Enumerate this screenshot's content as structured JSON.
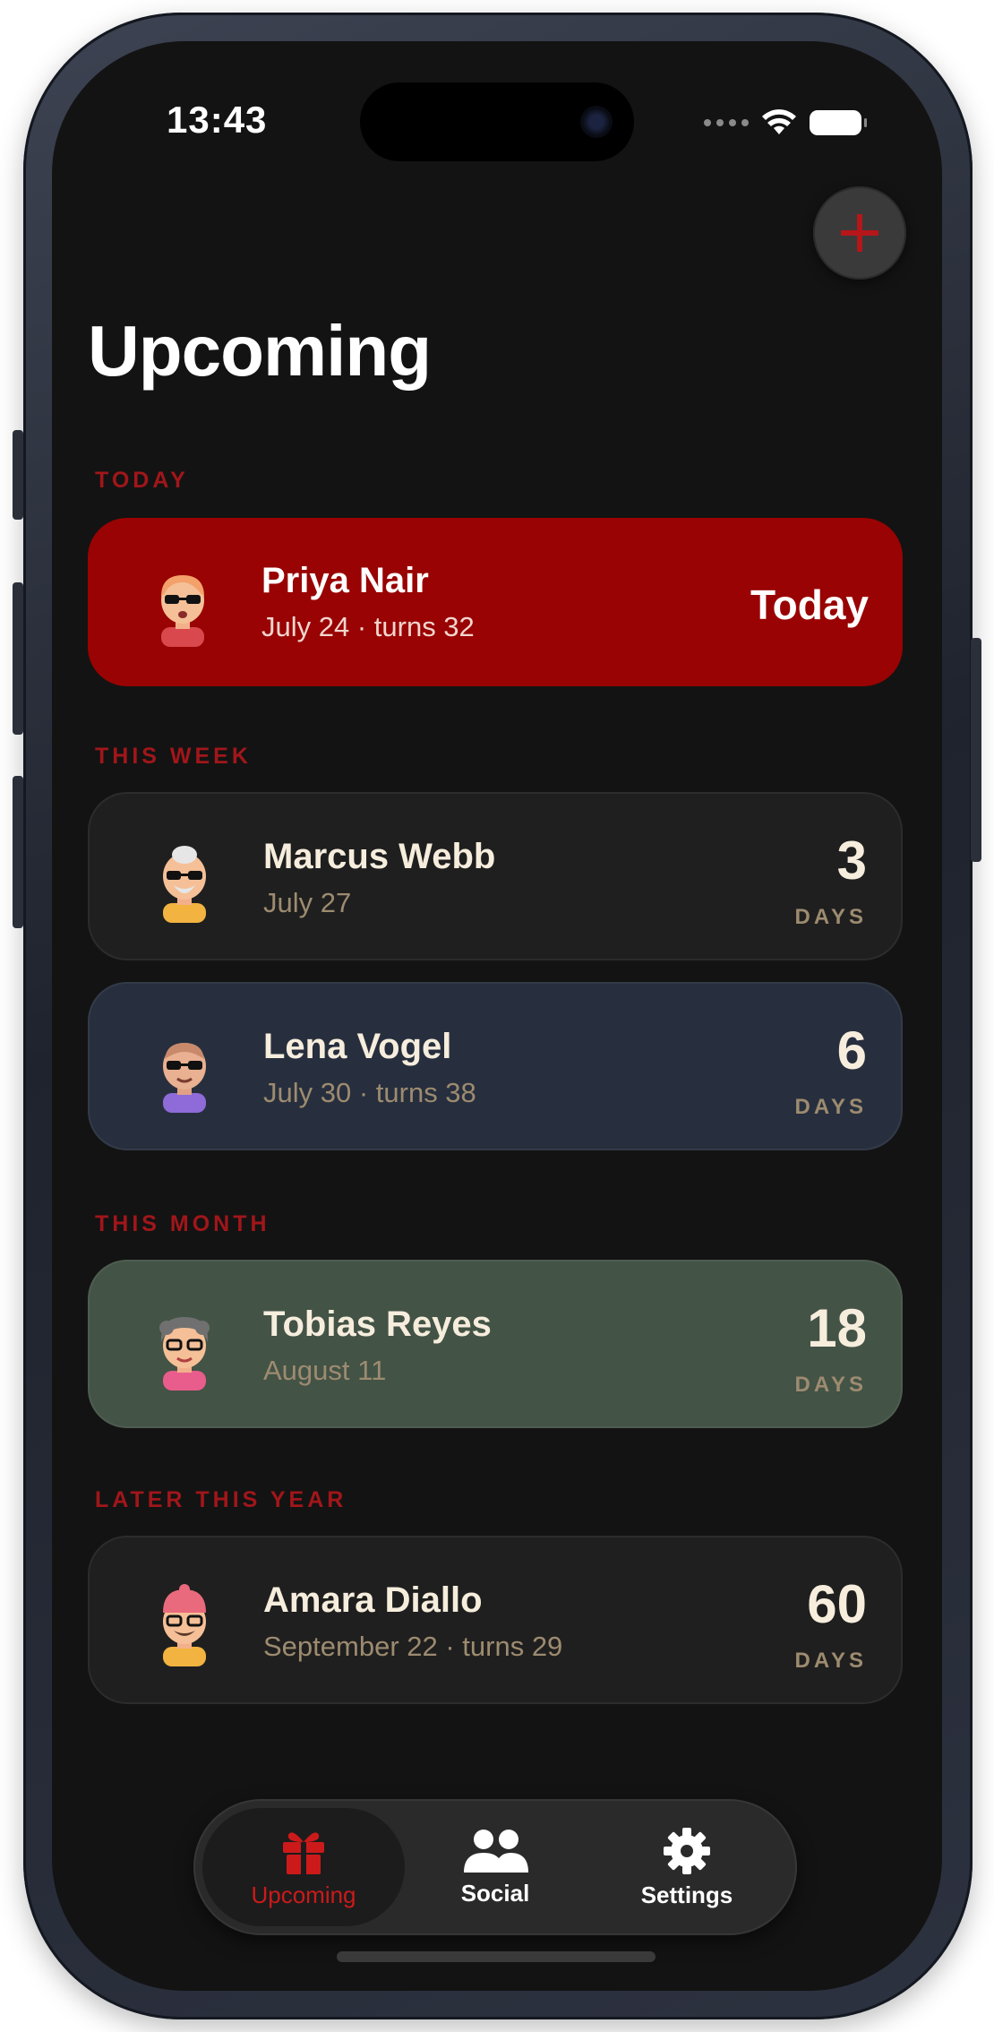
{
  "status": {
    "time": "13:43"
  },
  "header": {
    "title": "Upcoming",
    "add_icon": "plus-icon"
  },
  "colors": {
    "accent": "#990303",
    "section_label": "#a1161a",
    "cream": "#f6eddd",
    "muted": "#9d8b70"
  },
  "sections": [
    {
      "label": "TODAY",
      "cards": [
        {
          "name": "Priya Nair",
          "sub": "July 24 · turns 32",
          "badge": "Today",
          "style": "today"
        }
      ]
    },
    {
      "label": "THIS WEEK",
      "cards": [
        {
          "name": "Marcus Webb",
          "sub": "July 27",
          "days": "3",
          "unit": "DAYS",
          "style": "dark"
        },
        {
          "name": "Lena Vogel",
          "sub": "July 30 · turns 38",
          "days": "6",
          "unit": "DAYS",
          "style": "navy"
        }
      ]
    },
    {
      "label": "THIS MONTH",
      "cards": [
        {
          "name": "Tobias Reyes",
          "sub": "August 11",
          "days": "18",
          "unit": "DAYS",
          "style": "green"
        }
      ]
    },
    {
      "label": "LATER THIS YEAR",
      "cards": [
        {
          "name": "Amara Diallo",
          "sub": "September 22 · turns 29",
          "days": "60",
          "unit": "DAYS",
          "style": "dark"
        }
      ]
    }
  ],
  "tabbar": {
    "tabs": [
      {
        "label": "Upcoming",
        "icon": "gift-icon",
        "active": true
      },
      {
        "label": "Social",
        "icon": "people-icon",
        "active": false
      },
      {
        "label": "Settings",
        "icon": "gear-icon",
        "active": false
      }
    ]
  }
}
